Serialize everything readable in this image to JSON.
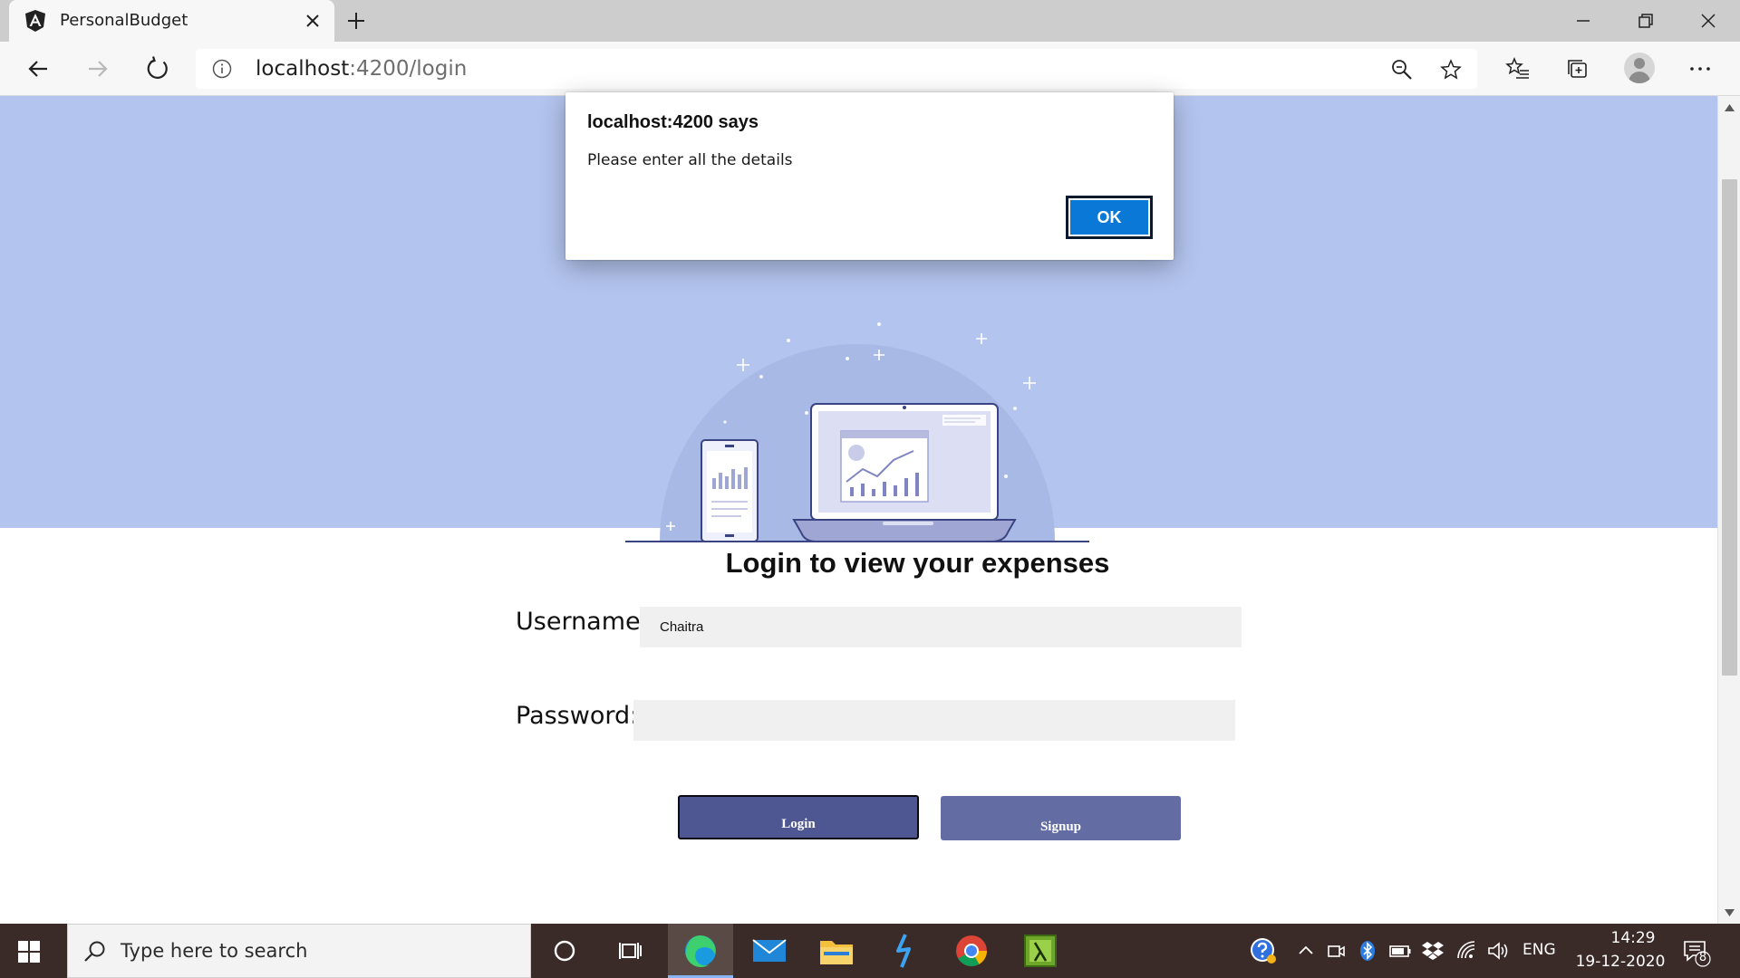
{
  "browser": {
    "tab_title": "PersonalBudget",
    "url_host": "localhost",
    "url_rest": ":4200/login"
  },
  "page": {
    "heading": "Login to view your expenses",
    "username_label": "Username:",
    "username_value": "Chaitra",
    "password_label": "Password:",
    "password_value": "",
    "login_label": "Login",
    "signup_label": "Signup"
  },
  "dialog": {
    "title": "localhost:4200 says",
    "message": "Please enter all the details",
    "ok_label": "OK"
  },
  "taskbar": {
    "search_placeholder": "Type here to search",
    "language": "ENG",
    "time": "14:29",
    "date": "19-12-2020",
    "notification_count": "8",
    "apps": [
      "cortana-icon",
      "task-view-icon",
      "edge-icon",
      "mail-icon",
      "file-explorer-icon",
      "visual-studio-icon",
      "chrome-icon",
      "app-icon"
    ]
  },
  "colors": {
    "hero_background": "#b3c4ee",
    "login_button": "#4f5792",
    "signup_button": "#636ca3",
    "dialog_ok": "#0a78d7"
  }
}
